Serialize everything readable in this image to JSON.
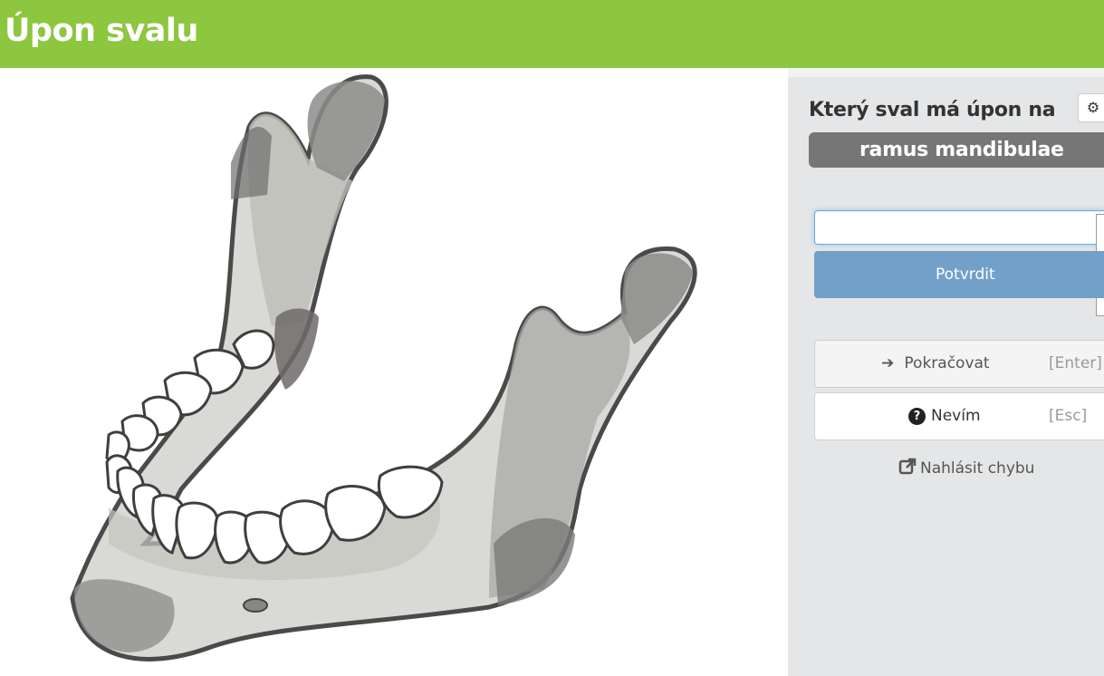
{
  "header": {
    "title": "Úpon svalu",
    "background_color": "#8dc63f"
  },
  "figure": {
    "subject": "mandible illustration"
  },
  "panel": {
    "question_label": "Který sval má úpon na",
    "term": "ramus mandibulae",
    "settings_icon": "gear-icon",
    "answer_input": {
      "value": "",
      "placeholder": ""
    },
    "confirm_label": "Potvrdit",
    "continue": {
      "icon": "arrow-right-icon",
      "label": "Pokračovat",
      "shortcut": "[Enter]"
    },
    "dont_know": {
      "icon": "question-circle-icon",
      "label": "Nevím",
      "shortcut": "[Esc]"
    },
    "report": {
      "icon": "external-link-icon",
      "label": "Nahlásit chybu"
    }
  },
  "colors": {
    "accent_green": "#8dc63f",
    "confirm_blue": "#72a0c9",
    "term_gray": "#767676",
    "panel_bg": "#e5e6e7"
  }
}
